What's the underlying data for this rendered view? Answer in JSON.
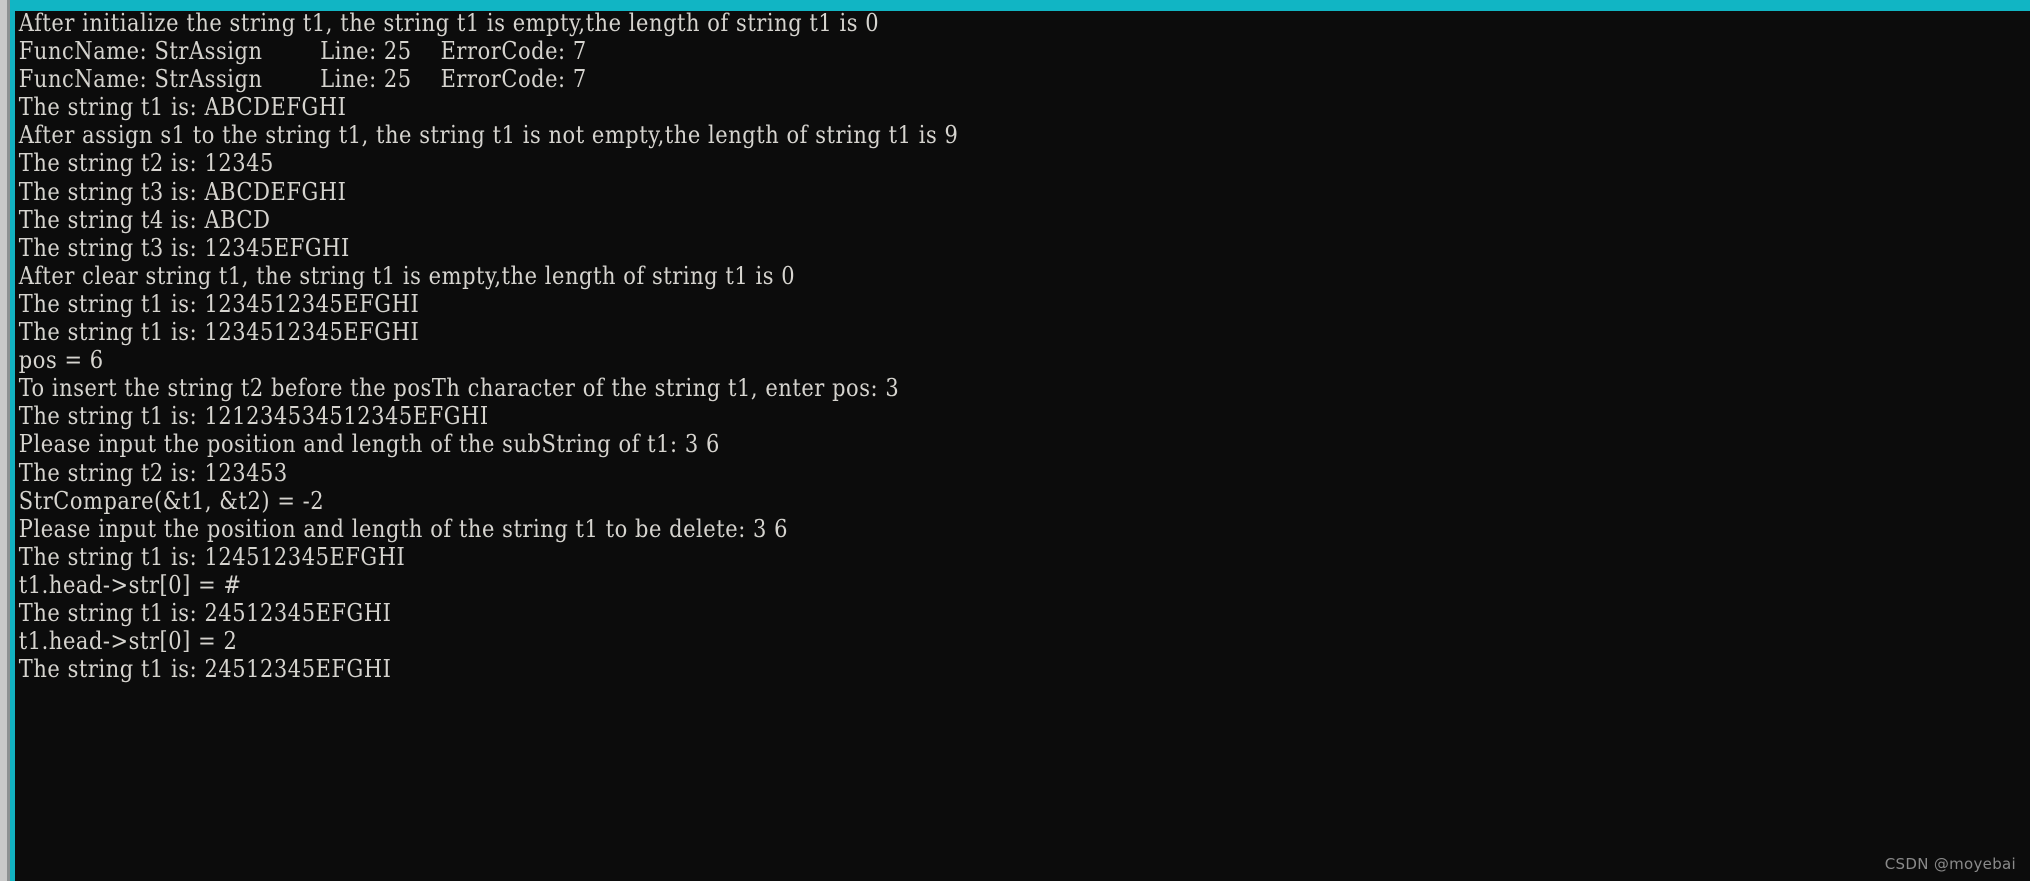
{
  "window": {
    "type": "console-terminal",
    "accent_color": "#11b5c4",
    "frame_color": "#c9c9c9",
    "background_color": "#0c0c0c",
    "text_color": "#d6d4cf"
  },
  "console": {
    "lines": [
      "After initialize the string t1, the string t1 is empty,the length of string t1 is 0",
      "FuncName: StrAssign        Line: 25    ErrorCode: 7",
      "FuncName: StrAssign        Line: 25    ErrorCode: 7",
      "The string t1 is: ABCDEFGHI",
      "After assign s1 to the string t1, the string t1 is not empty,the length of string t1 is 9",
      "The string t2 is: 12345",
      "The string t3 is: ABCDEFGHI",
      "The string t4 is: ABCD",
      "The string t3 is: 12345EFGHI",
      "After clear string t1, the string t1 is empty,the length of string t1 is 0",
      "The string t1 is: 1234512345EFGHI",
      "The string t1 is: 1234512345EFGHI",
      "pos = 6",
      "To insert the string t2 before the posTh character of the string t1, enter pos: 3",
      "The string t1 is: 121234534512345EFGHI",
      "Please input the position and length of the subString of t1: 3 6",
      "The string t2 is: 123453",
      "StrCompare(&t1, &t2) = -2",
      "Please input the position and length of the string t1 to be delete: 3 6",
      "The string t1 is: 124512345EFGHI",
      "t1.head->str[0] = #",
      "The string t1 is: 24512345EFGHI",
      "t1.head->str[0] = 2",
      "The string t1 is: 24512345EFGHI"
    ]
  },
  "watermark": {
    "text": "CSDN @moyebai"
  }
}
